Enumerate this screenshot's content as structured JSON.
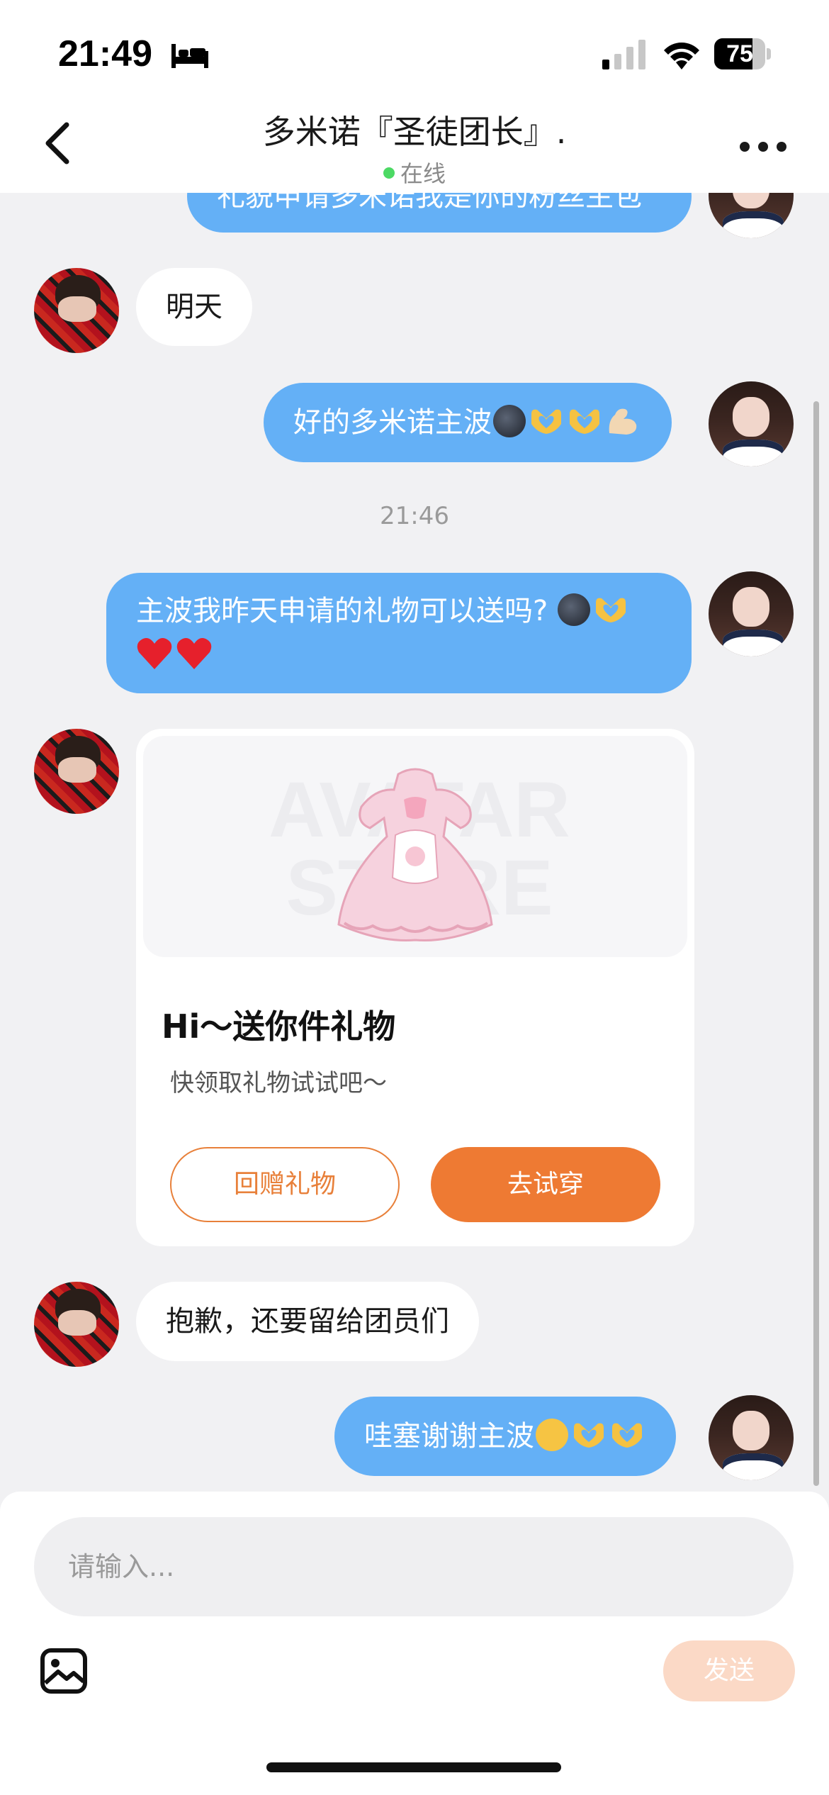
{
  "status_bar": {
    "time": "21:49",
    "battery": "75",
    "battery_level": 0.75,
    "icons": [
      "bed-icon",
      "cellular-signal-icon",
      "wifi-icon",
      "battery-icon"
    ]
  },
  "header": {
    "title": "多米诺『圣徒团长』.",
    "status": "在线",
    "status_color": "#4cd964",
    "icons": [
      "back-chevron-icon",
      "more-dots-icon"
    ]
  },
  "messages": {
    "partial_top": "礼貌申请多米诺我是你的粉丝主包",
    "m1": "明天",
    "m2": "好的多米诺主波",
    "time_divider": "21:46",
    "m3_line1": "主波我昨天申请的礼物可以送吗?",
    "m5": "抱歉，还要留给团员们",
    "m6": "哇塞谢谢主波"
  },
  "gift_card": {
    "watermark": "AVATAR STORE",
    "title": "Hi～送你件礼物",
    "subtitle": "快领取礼物试试吧～",
    "return_gift_label": "回赠礼物",
    "try_on_label": "去试穿",
    "accent_color": "#ee7a33"
  },
  "composer": {
    "placeholder": "请输入...",
    "send_label": "发送",
    "icons": [
      "image-gallery-icon"
    ]
  },
  "colors": {
    "outgoing_bubble": "#64b0f6",
    "incoming_bubble": "#ffffff",
    "background": "#f1f1f3"
  }
}
